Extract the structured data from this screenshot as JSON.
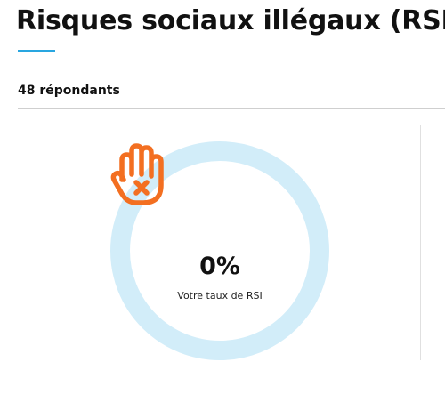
{
  "header": {
    "title": "Risques sociaux illégaux (RSI)",
    "accent_color": "#29a6e0"
  },
  "summary": {
    "respondents": "48 répondants"
  },
  "gauge": {
    "value_text": "0%",
    "value": 0,
    "label": "Votre taux de RSI",
    "icon": "stop-hand-icon",
    "icon_color": "#f36f21",
    "ring_color": "#d2edf9"
  }
}
